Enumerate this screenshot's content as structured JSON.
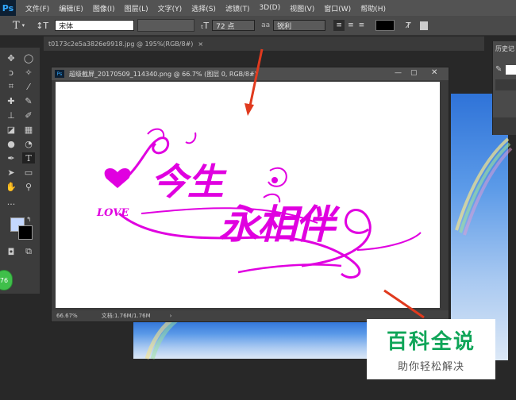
{
  "app": {
    "logo": "Ps"
  },
  "menu": [
    "文件(F)",
    "编辑(E)",
    "图像(I)",
    "图层(L)",
    "文字(Y)",
    "选择(S)",
    "滤镜(T)",
    "3D(D)",
    "视图(V)",
    "窗口(W)",
    "帮助(H)"
  ],
  "options": {
    "tool_glyph": "T",
    "font_family": "宋体",
    "font_size": "72 点",
    "antialias": "锐利",
    "text_color": "#000000"
  },
  "tabs": {
    "background_doc": "t0173c2e5a3826e9918.jpg @ 195%(RGB/8#)"
  },
  "document": {
    "title": "超级截屏_20170509_114340.png @ 66.7% (图层 0, RGB/8#)",
    "zoom": "66.67%",
    "doc_size": "文档:1.76M/1.76M",
    "artwork": {
      "latin": "LOVE",
      "word1": "今生",
      "word2": "永相伴"
    }
  },
  "panel": {
    "history_label": "历史记"
  },
  "badge": {
    "value": "76"
  },
  "watermark": {
    "title": "百科全说",
    "subtitle": "助你轻松解决"
  },
  "colors": {
    "artwork": "#e000e0",
    "arrow": "#e03a1e",
    "watermark_green": "#0fa558"
  }
}
